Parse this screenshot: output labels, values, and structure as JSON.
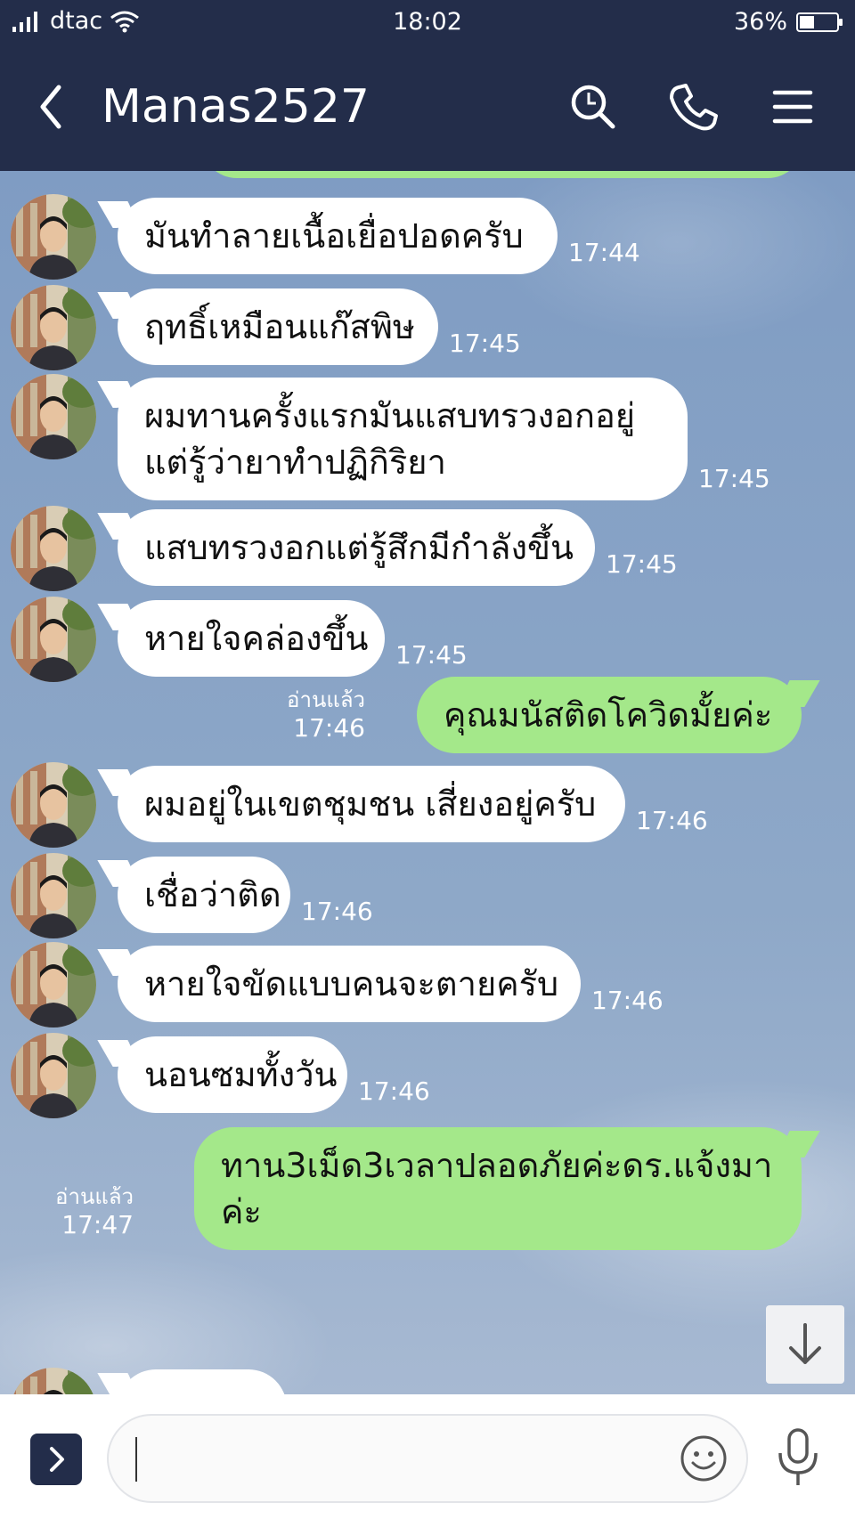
{
  "status_bar": {
    "carrier": "dtac",
    "time": "18:02",
    "battery": "36%",
    "battery_level": 0.36
  },
  "header": {
    "title": "Manas2527",
    "back_icon": "chevron-left-icon",
    "search_icon": "search-icon",
    "call_icon": "phone-icon",
    "menu_icon": "hamburger-menu-icon"
  },
  "messages": [
    {
      "side": "in",
      "lines": [
        "มันทำลายเนื้อเยื่อปอดครับ"
      ],
      "time": "17:44"
    },
    {
      "side": "in",
      "lines": [
        "ฤทธิ์เหมือนแก๊สพิษ"
      ],
      "time": "17:45"
    },
    {
      "side": "in",
      "lines": [
        "ผมทานครั้งแรกมันแสบทรวงอกอยู่",
        "แต่รู้ว่ายาทำปฏิกิริยา"
      ],
      "time": "17:45"
    },
    {
      "side": "in",
      "lines": [
        "แสบทรวงอกแต่รู้สึกมีกำลังขึ้น"
      ],
      "time": "17:45"
    },
    {
      "side": "in",
      "lines": [
        "หายใจคล่องขึ้น"
      ],
      "time": "17:45"
    },
    {
      "side": "out",
      "lines": [
        "คุณมนัสติดโควิดมั้ยค่ะ"
      ],
      "read": "อ่านแล้ว",
      "time": "17:46"
    },
    {
      "side": "in",
      "lines": [
        "ผมอยู่ในเขตชุมชน เสี่ยงอยู่ครับ"
      ],
      "time": "17:46"
    },
    {
      "side": "in",
      "lines": [
        "เชื่อว่าติด"
      ],
      "time": "17:46"
    },
    {
      "side": "in",
      "lines": [
        "หายใจขัดแบบคนจะตายครับ"
      ],
      "time": "17:46"
    },
    {
      "side": "in",
      "lines": [
        "นอนซมทั้งวัน"
      ],
      "time": "17:46"
    },
    {
      "side": "out",
      "lines": [
        "ทาน3เม็ด3เวลาปลอดภัยค่ะดร.แจ้งมา",
        "ค่ะ"
      ],
      "read": "อ่านแล้ว",
      "time": "17:47"
    }
  ],
  "composer": {
    "expand_icon": "chevron-right-icon",
    "emoji_icon": "smiley-icon",
    "mic_icon": "microphone-icon",
    "scroll_icon": "arrow-down-icon"
  },
  "colors": {
    "header": "#232d4a",
    "outgoing_bubble": "#a4e88a",
    "incoming_bubble": "#ffffff",
    "chat_background": "#8aa4c8"
  }
}
